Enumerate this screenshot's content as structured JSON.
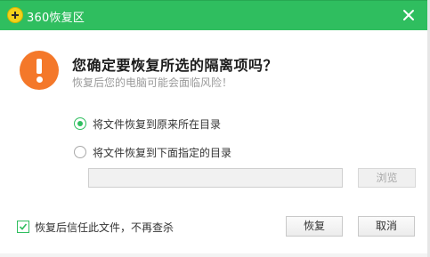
{
  "window": {
    "title": "360恢复区",
    "accent_color": "#2fbe5f"
  },
  "dialog": {
    "icon": "warning-icon",
    "question": "您确定要恢复所选的隔离项吗？",
    "subtext": "恢复后您的电脑可能会面临风险！"
  },
  "options": [
    {
      "label": "将文件恢复到原来所在目录",
      "selected": true
    },
    {
      "label": "将文件恢复到下面指定的目录",
      "selected": false
    }
  ],
  "path_input": {
    "value": "",
    "placeholder": ""
  },
  "browse_label": "浏览",
  "trust_checkbox": {
    "label": "恢复后信任此文件，不再查杀",
    "checked": true
  },
  "buttons": {
    "restore": "恢复",
    "cancel": "取消"
  }
}
